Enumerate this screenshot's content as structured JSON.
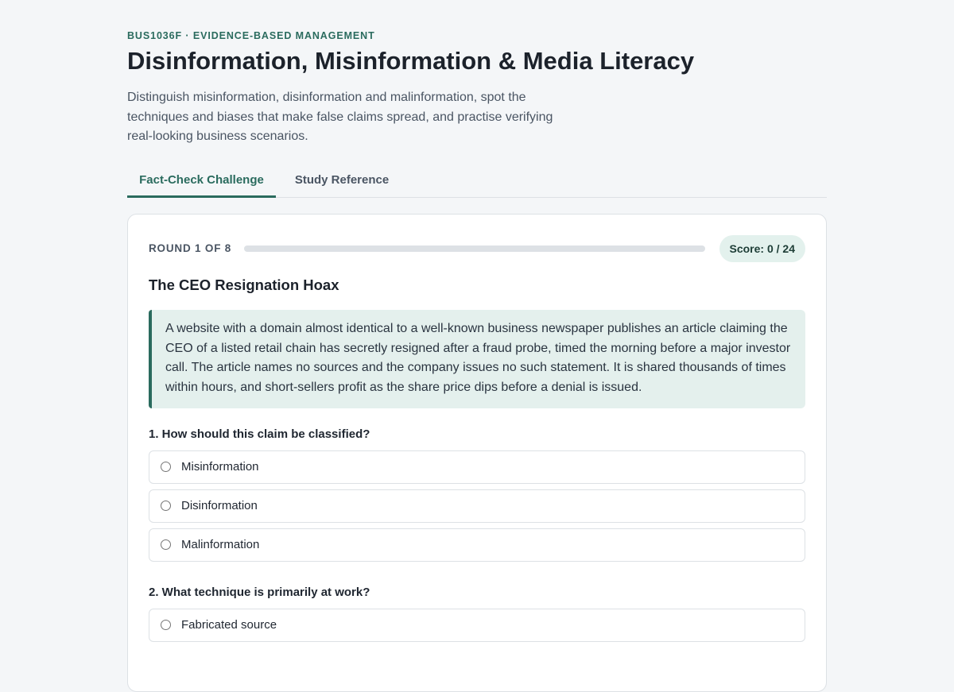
{
  "header": {
    "course": "BUS1036F · EVIDENCE-BASED MANAGEMENT",
    "title": "Disinformation, Misinformation & Media Literacy",
    "subtitle": "Distinguish misinformation, disinformation and malinformation, spot the techniques and biases that make false claims spread, and practise verifying real-looking business scenarios."
  },
  "tabs": [
    {
      "label": "Fact-Check Challenge",
      "active": true
    },
    {
      "label": "Study Reference",
      "active": false
    }
  ],
  "round": {
    "label": "ROUND 1 OF 8",
    "progress": 0,
    "score": "Score: 0 / 24"
  },
  "scenario": {
    "title": "The CEO Resignation Hoax",
    "text": "A website with a domain almost identical to a well-known business newspaper publishes an article claiming the CEO of a listed retail chain has secretly resigned after a fraud probe, timed the morning before a major investor call. The article names no sources and the company issues no such statement. It is shared thousands of times within hours, and short-sellers profit as the share price dips before a denial is issued."
  },
  "questions": [
    {
      "label": "1. How should this claim be classified?",
      "options": [
        "Misinformation",
        "Disinformation",
        "Malinformation"
      ]
    },
    {
      "label": "2. What technique is primarily at work?",
      "options": [
        "Fabricated source"
      ]
    }
  ],
  "colors": {
    "accent": "#2a6b5e",
    "scenario_bg": "#e4f0ed",
    "score_bg": "#e3f1ed",
    "page_bg": "#f4f6f8"
  }
}
